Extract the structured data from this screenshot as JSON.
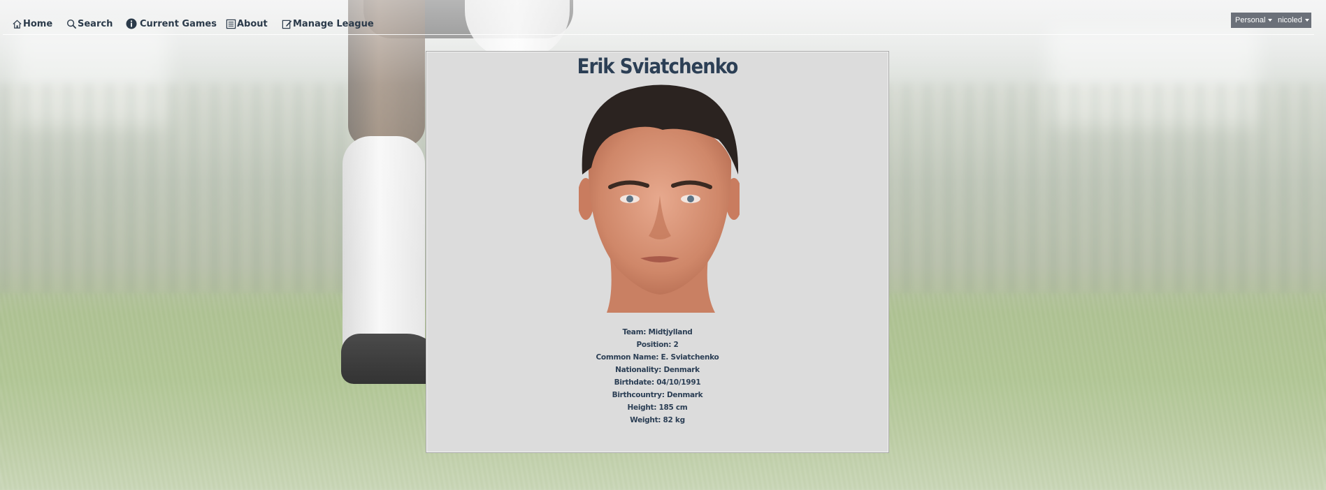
{
  "nav": {
    "home": "Home",
    "search": "Search",
    "current_games": "Current Games",
    "about": "About",
    "manage_league": "Manage League"
  },
  "account": {
    "personal": "Personal",
    "username": "nicoled"
  },
  "player": {
    "name": "Erik Sviatchenko",
    "stats": [
      "Team: Midtjylland",
      "Position: 2",
      "Common Name: E. Sviatchenko",
      "Nationality: Denmark",
      "Birthdate: 04/10/1991",
      "Birthcountry: Denmark",
      "Height: 185 cm",
      "Weight: 82 kg"
    ]
  },
  "colors": {
    "nav_text": "#2b3a4a",
    "card_bg": "#dcdcdc",
    "heading": "#2c3f55",
    "dropdown_bg": "#6b7079"
  },
  "icons": {
    "home": "home-icon",
    "search": "search-icon",
    "current_games": "info-icon",
    "about": "list-icon",
    "manage_league": "edit-icon"
  }
}
